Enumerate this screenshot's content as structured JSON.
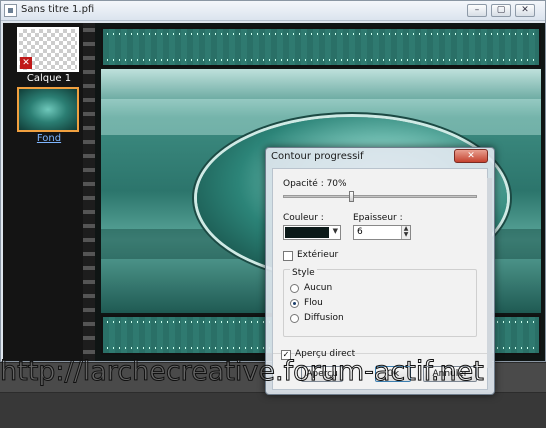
{
  "window": {
    "title": "Sans titre 1.pfi",
    "buttons": [
      "–",
      "▢",
      "✕"
    ]
  },
  "layers": [
    {
      "name": "Calque 1",
      "selected": false
    },
    {
      "name": "Fond",
      "selected": true
    }
  ],
  "dialog": {
    "title": "Contour progressif",
    "close_label": "✕",
    "opacity_label": "Opacité : 70%",
    "opacity_value": 70,
    "color_label": "Couleur :",
    "color_value": "#0c1a19",
    "thickness_label": "Epaisseur :",
    "thickness_value": "6",
    "exterior_label": "Extérieur",
    "exterior_checked": false,
    "style_group_label": "Style",
    "style_options": [
      "Aucun",
      "Flou",
      "Diffusion"
    ],
    "style_selected": "Flou",
    "preview_label": "Aperçu direct",
    "preview_checked": true,
    "buttons": {
      "reset": "Aperçu",
      "ok": "Ok",
      "cancel": "Annuler"
    }
  },
  "watermark": "http://larchecreative.forum-actif.net",
  "colors": {
    "accent": "#2c7e73",
    "selected_border": "#f0a040"
  }
}
